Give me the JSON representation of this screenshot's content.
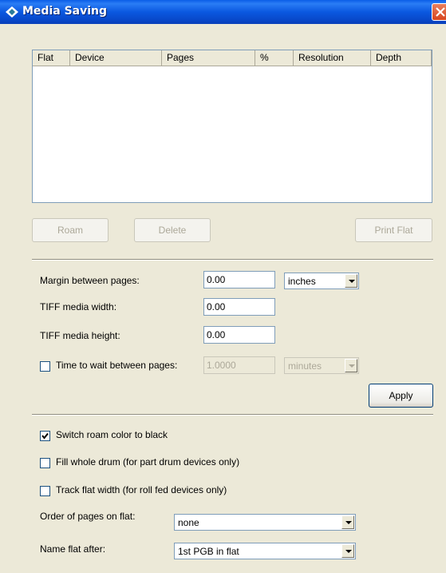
{
  "window": {
    "title": "Media Saving",
    "close_icon": "close-icon"
  },
  "list": {
    "columns": [
      "Flat",
      "Device",
      "Pages",
      "%",
      "Resolution",
      "Depth"
    ],
    "rows": []
  },
  "buttons": {
    "roam": "Roam",
    "delete": "Delete",
    "print_flat": "Print Flat",
    "apply": "Apply"
  },
  "page_settings": {
    "margin_label": "Margin between pages:",
    "margin_value": "0.00",
    "margin_unit": "inches",
    "tiff_width_label": "TIFF media width:",
    "tiff_width_value": "0.00",
    "tiff_height_label": "TIFF media height:",
    "tiff_height_value": "0.00",
    "wait_label": "Time to wait between pages:",
    "wait_checked": false,
    "wait_value": "1.0000",
    "wait_unit": "minutes"
  },
  "options": {
    "switch_roam_label": "Switch roam color to black",
    "switch_roam_checked": true,
    "fill_drum_label": "Fill whole drum (for part drum devices only)",
    "fill_drum_checked": false,
    "track_width_label": "Track flat width (for roll fed devices only)",
    "track_width_checked": false,
    "order_label": "Order of pages on flat:",
    "order_value": "none",
    "name_label": "Name flat after:",
    "name_value": "1st PGB in flat"
  },
  "colors": {
    "titlebar": "#0a58e0",
    "dialog_bg": "#ece9d8",
    "close_button": "#d8451f"
  }
}
